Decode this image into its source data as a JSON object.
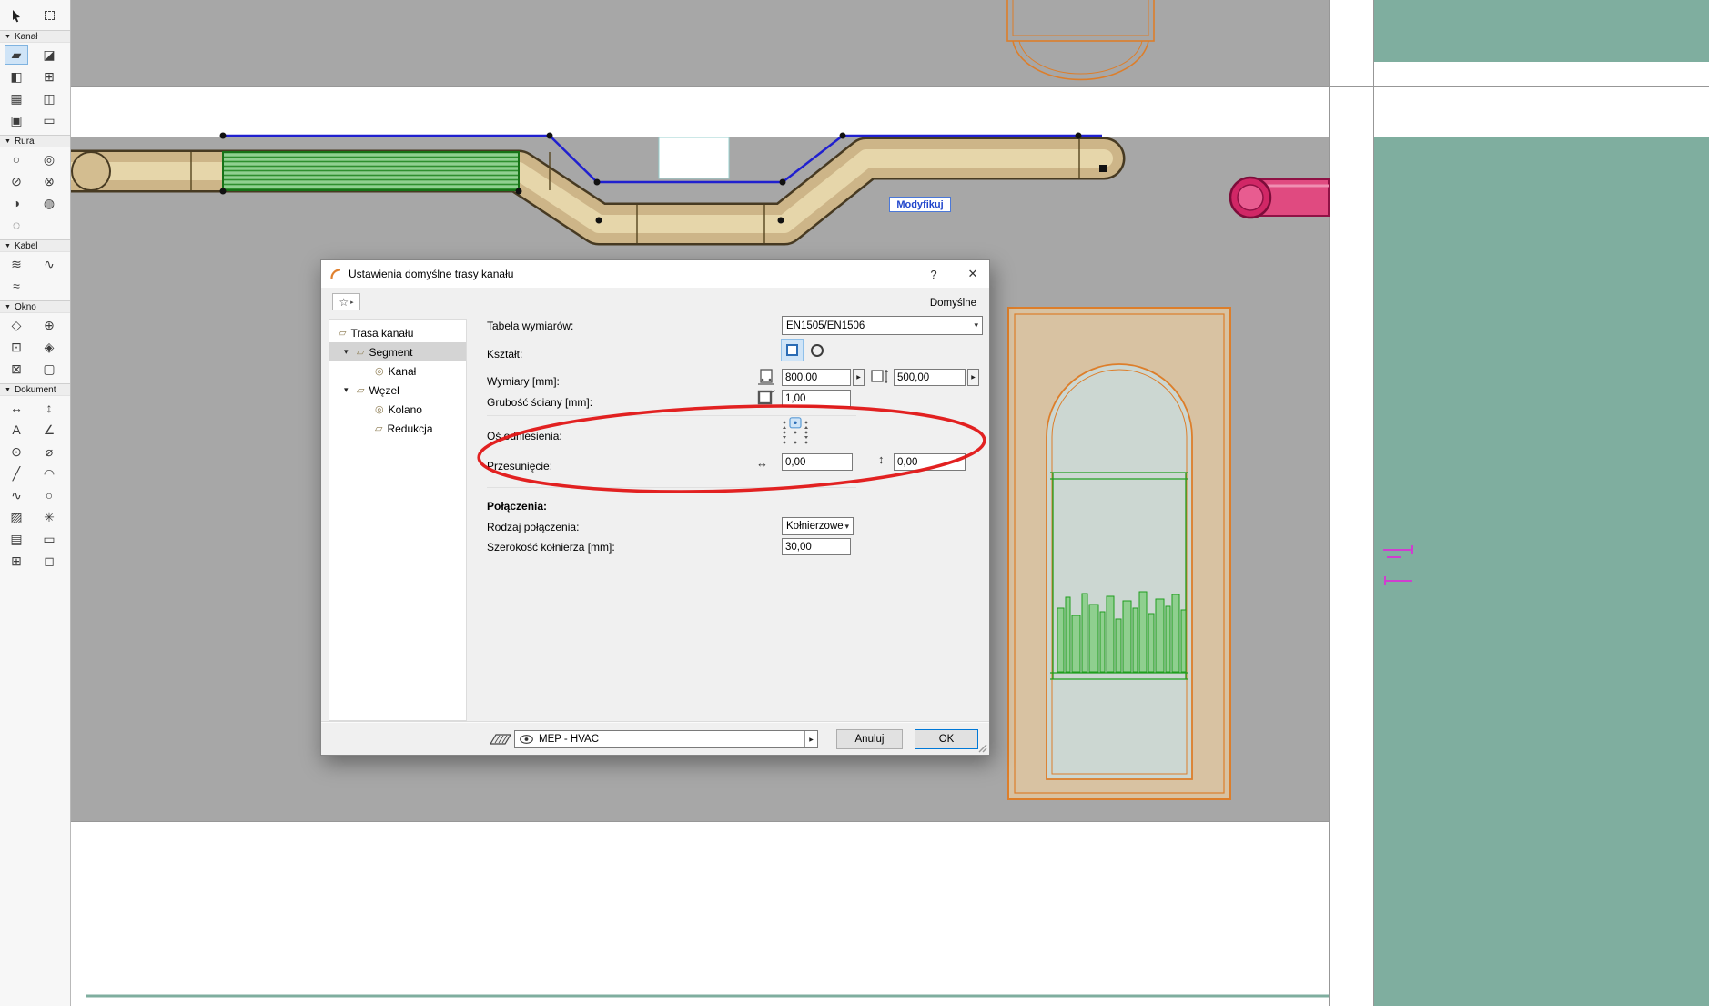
{
  "sidebar": {
    "sections": [
      {
        "label": "Kanał",
        "tools": [
          "duct-tool",
          "duct-bend-tool",
          "duct-tee-tool",
          "duct-takeoff-tool",
          "duct-cross-tool",
          "duct-transition-tool",
          "duct-offset-tool",
          "duct-endcap-tool"
        ]
      },
      {
        "label": "Rura",
        "tools": [
          "pipe-tool",
          "pipe-bend-tool",
          "pipe-tee-tool",
          "pipe-takeoff-tool",
          "pipe-transition-tool",
          "pipe-valve-tool",
          "pipe-endcap-tool"
        ]
      },
      {
        "label": "Kabel",
        "tools": [
          "cabletray-tool",
          "cabletray-bend-tool",
          "cabletray-riser-tool"
        ]
      },
      {
        "label": "Okno",
        "tools": [
          "grid-marker-tool",
          "rotated-grid-tool",
          "hotspot-tool",
          "detail-tool",
          "sketch-tool",
          "camera-tool"
        ]
      },
      {
        "label": "Dokument",
        "tools": [
          "dimension-tool",
          "level-dimension-tool",
          "text-tool",
          "angle-dimension-tool",
          "label-tool",
          "diameter-dimension-tool",
          "line-tool",
          "arc-tool",
          "spline-tool",
          "circle-tool",
          "fill-tool",
          "star-tool",
          "zone-tool",
          "figure-tool",
          "drawing-tool",
          "patch-tool"
        ]
      }
    ]
  },
  "canvas": {
    "modify_button": "Modyfikuj"
  },
  "dialog": {
    "title": "Ustawienia domyślne trasy kanału",
    "defaults_label": "Domyślne",
    "tree": {
      "items": [
        {
          "label": "Trasa kanału"
        },
        {
          "label": "Segment"
        },
        {
          "label": "Kanał"
        },
        {
          "label": "Węzeł"
        },
        {
          "label": "Kolano"
        },
        {
          "label": "Redukcja"
        }
      ]
    },
    "form": {
      "dimension_table_label": "Tabela wymiarów:",
      "dimension_table_value": "EN1505/EN1506",
      "shape_label": "Kształt:",
      "dimensions_label": "Wymiary [mm]:",
      "width_value": "800,00",
      "height_value": "500,00",
      "wall_thickness_label": "Grubość ściany [mm]:",
      "wall_thickness_value": "1,00",
      "reference_axis_label": "Oś odniesienia:",
      "offset_label": "Przesunięcie:",
      "offset_x_value": "0,00",
      "offset_y_value": "0,00",
      "connections_header": "Połączenia:",
      "connection_type_label": "Rodzaj połączenia:",
      "connection_type_value": "Kołnierzowe",
      "flange_width_label": "Szerokość kołnierza [mm]:",
      "flange_width_value": "30,00"
    },
    "footer": {
      "layer_value": "MEP - HVAC",
      "cancel_label": "Anuluj",
      "ok_label": "OK"
    },
    "colors": {
      "annotation_red": "#e01515",
      "selection_blue": "#cfe4f7",
      "duct_tan": "#cdb588",
      "route_blue": "#2020cf",
      "highlight_green": "#8fcf8f",
      "pipe_magenta": "#e04a80",
      "panel_teal": "#7fae9f",
      "drawing_orange": "#dd7e2a"
    }
  }
}
